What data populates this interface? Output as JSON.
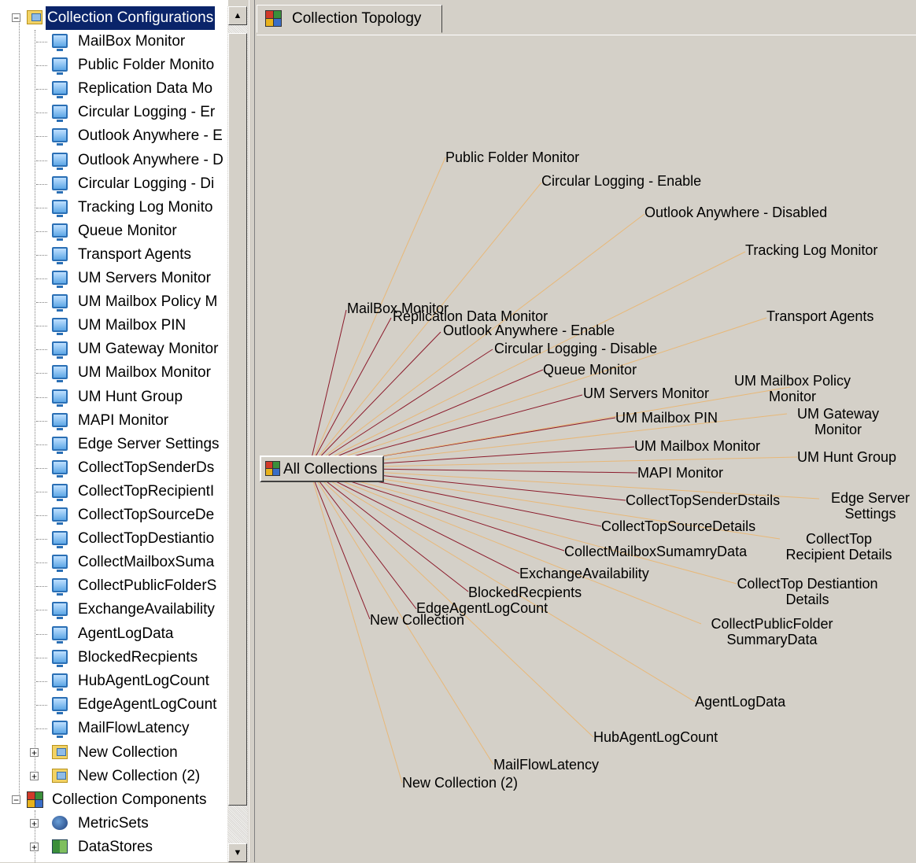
{
  "tree": {
    "root_label": "Collection Configurations",
    "items": [
      "MailBox Monitor",
      "Public Folder Monito",
      "Replication Data Mo",
      "Circular Logging - Er",
      "Outlook Anywhere - E",
      "Outlook Anywhere - D",
      "Circular Logging - Di",
      "Tracking Log Monito",
      "Queue Monitor",
      "Transport Agents",
      "UM Servers Monitor",
      "UM Mailbox Policy M",
      "UM Mailbox PIN",
      "UM Gateway Monitor",
      "UM Mailbox Monitor",
      "UM Hunt Group",
      "MAPI Monitor",
      "Edge Server Settings",
      "CollectTopSenderDs",
      "CollectTopRecipientI",
      "CollectTopSourceDe",
      "CollectTopDestiantio",
      "CollectMailboxSuma",
      "CollectPublicFolderS",
      "ExchangeAvailability",
      "AgentLogData",
      "BlockedRecpients",
      "HubAgentLogCount",
      "EdgeAgentLogCount",
      "MailFlowLatency"
    ],
    "collections": [
      "New Collection",
      "New Collection (2)"
    ],
    "components_label": "Collection Components",
    "components": [
      "MetricSets",
      "DataStores"
    ]
  },
  "tab": {
    "label": "Collection Topology"
  },
  "topology": {
    "root": "All Collections",
    "nodes": [
      "MailBox Monitor",
      "Replication Data Monitor",
      "Outlook Anywhere - Enable",
      "Circular Logging - Disable",
      "Queue Monitor",
      "UM Servers Monitor",
      "UM Mailbox PIN",
      "UM Mailbox Monitor",
      "MAPI Monitor",
      "CollectTopSenderDstails",
      "CollectTopSourceDetails",
      "CollectMailboxSumamryData",
      "ExchangeAvailability",
      "BlockedRecpients",
      "EdgeAgentLogCount",
      "New Collection",
      "Public Folder Monitor",
      "Circular Logging - Enable",
      "Outlook Anywhere - Disabled",
      "Tracking Log Monitor",
      "Transport Agents",
      "UM Mailbox Policy Monitor",
      "UM Gateway Monitor",
      "UM Hunt Group",
      "Edge Server Settings",
      "CollectTop Recipient Details",
      "CollectTop Destiantion Details",
      "CollectPublicFolder SummaryData",
      "AgentLogData",
      "HubAgentLogCount",
      "MailFlowLatency",
      "New Collection (2)"
    ]
  },
  "colors": {
    "inner_edge": "#8b1a2b",
    "outer_edge": "#e8b878",
    "selection": "#0a246a"
  }
}
